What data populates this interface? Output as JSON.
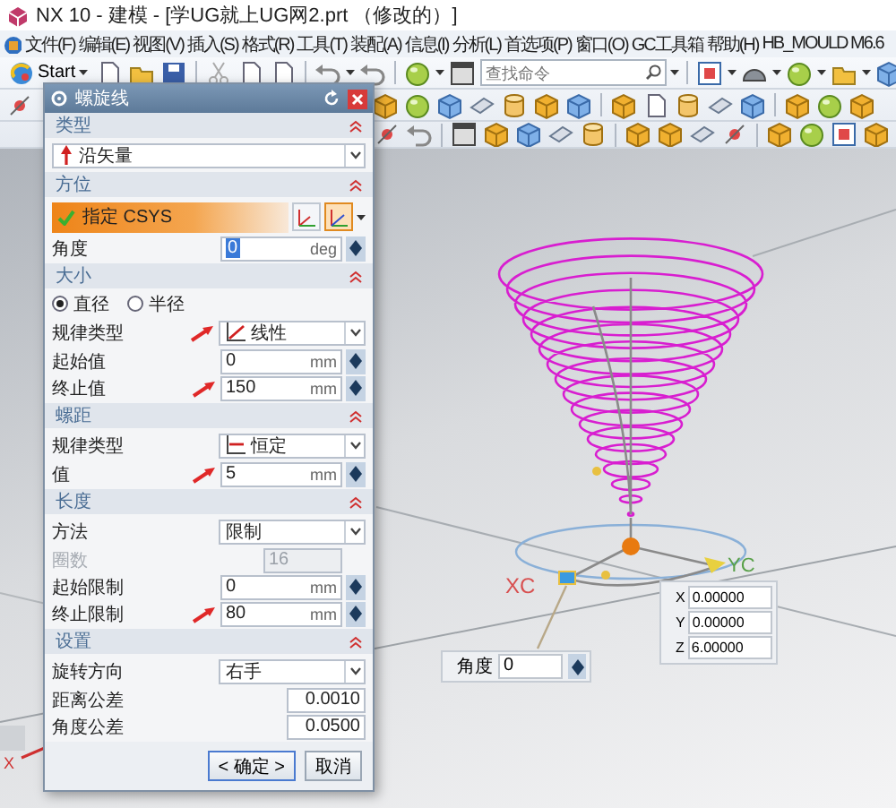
{
  "window": {
    "title": "NX 10 - 建模 - [学UG就上UG网2.prt （修改的）]"
  },
  "menu_bar": [
    "文件(F)",
    "编辑(E)",
    "视图(V)",
    "插入(S)",
    "格式(R)",
    "工具(T)",
    "装配(A)",
    "信息(I)",
    "分析(L)",
    "首选项(P)",
    "窗口(O)",
    "GC工具箱",
    "帮助(H)",
    "HB_MOULD M6.6"
  ],
  "toolbar": {
    "start_label": "Start",
    "search": {
      "placeholder": "查找命令"
    }
  },
  "dialog": {
    "title": "螺旋线",
    "sections": [
      {
        "title": "类型",
        "expanded": true,
        "rows": [
          {
            "kind": "dropdown",
            "value": "沿矢量",
            "pointer": false
          }
        ]
      },
      {
        "title": "方位",
        "expanded": true,
        "rows": [
          {
            "kind": "csys",
            "label": "指定 CSYS",
            "done": true
          },
          {
            "kind": "number",
            "label": "角度",
            "value": "0",
            "unit": "deg",
            "highlighted": true,
            "disabled": false,
            "pointer": false
          }
        ]
      },
      {
        "title": "大小",
        "expanded": true,
        "rows": [
          {
            "kind": "radio",
            "options": [
              {
                "label": "直径",
                "selected": true
              },
              {
                "label": "半径",
                "selected": false
              }
            ]
          },
          {
            "kind": "dropdown",
            "label": "规律类型",
            "value": "线性",
            "pointer": true
          },
          {
            "kind": "number",
            "label": "起始值",
            "value": "0",
            "unit": "mm",
            "highlighted": false,
            "disabled": false,
            "pointer": false
          },
          {
            "kind": "number",
            "label": "终止值",
            "value": "150",
            "unit": "mm",
            "highlighted": false,
            "disabled": false,
            "pointer": true
          }
        ]
      },
      {
        "title": "螺距",
        "expanded": true,
        "rows": [
          {
            "kind": "dropdown",
            "label": "规律类型",
            "value": "恒定",
            "pointer": false
          },
          {
            "kind": "number",
            "label": "值",
            "value": "5",
            "unit": "mm",
            "highlighted": false,
            "disabled": false,
            "pointer": true
          }
        ]
      },
      {
        "title": "长度",
        "expanded": true,
        "rows": [
          {
            "kind": "dropdown",
            "label": "方法",
            "value": "限制",
            "pointer": false
          },
          {
            "kind": "count",
            "label": "圈数",
            "value": "16",
            "disabled": true
          },
          {
            "kind": "number",
            "label": "起始限制",
            "value": "0",
            "unit": "mm",
            "highlighted": false,
            "disabled": false,
            "pointer": false
          },
          {
            "kind": "number",
            "label": "终止限制",
            "value": "80",
            "unit": "mm",
            "highlighted": false,
            "disabled": false,
            "pointer": true
          }
        ]
      },
      {
        "title": "设置",
        "expanded": true,
        "rows": [
          {
            "kind": "dropdown",
            "label": "旋转方向",
            "value": "右手",
            "pointer": false
          },
          {
            "kind": "tolerance",
            "label": "距离公差",
            "value": "0.0010"
          },
          {
            "kind": "tolerance",
            "label": "角度公差",
            "value": "0.0500"
          }
        ]
      }
    ],
    "buttons": [
      {
        "label": "< 确定 >",
        "default": true
      },
      {
        "label": "取消",
        "default": false
      }
    ]
  },
  "viewport": {
    "axis_labels": [
      {
        "label": "XC",
        "color": "#d85050"
      },
      {
        "label": "YC",
        "color": "#58a048"
      },
      {
        "label": "X",
        "color": "#d03030"
      }
    ],
    "coordinates": [
      {
        "axis": "X",
        "value": "0.00000"
      },
      {
        "axis": "Y",
        "value": "0.00000"
      },
      {
        "axis": "Z",
        "value": "6.00000"
      }
    ],
    "angle_input": {
      "label": "角度",
      "value": "0"
    }
  }
}
